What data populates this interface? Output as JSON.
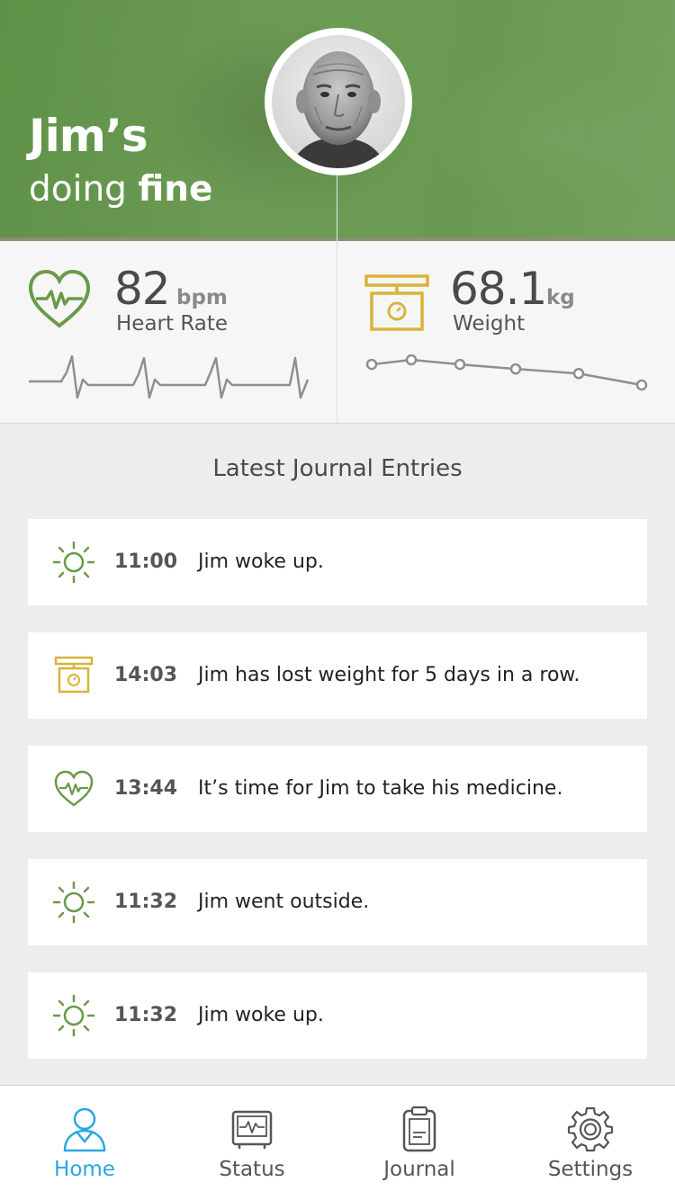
{
  "header": {
    "name": "Jim’s",
    "status_prefix": "doing",
    "status_word": "fine",
    "accent_color": "#6a9a52"
  },
  "stats": {
    "heart_rate": {
      "value": "82",
      "unit": "bpm",
      "label": "Heart Rate",
      "icon": "heart-icon",
      "color": "#6a9a4a"
    },
    "weight": {
      "value": "68.1",
      "unit": "kg",
      "label": "Weight",
      "icon": "scale-icon",
      "color": "#d8b43a",
      "trend": [
        69.0,
        69.2,
        69.0,
        68.8,
        68.6,
        68.1
      ]
    }
  },
  "journal": {
    "title": "Latest Journal Entries",
    "entries": [
      {
        "icon": "sun-icon",
        "time": "11:00",
        "text": "Jim woke up."
      },
      {
        "icon": "scale-icon",
        "time": "14:03",
        "text": "Jim has lost weight for 5 days in a row."
      },
      {
        "icon": "heart-icon",
        "time": "13:44",
        "text": "It’s time for Jim to take his medicine."
      },
      {
        "icon": "sun-icon",
        "time": "11:32",
        "text": "Jim went outside."
      },
      {
        "icon": "sun-icon",
        "time": "11:32",
        "text": "Jim woke up."
      }
    ]
  },
  "tabbar": {
    "active_color": "#2aa7e0",
    "tabs": [
      {
        "label": "Home",
        "icon": "person-icon",
        "active": true
      },
      {
        "label": "Status",
        "icon": "monitor-icon",
        "active": false
      },
      {
        "label": "Journal",
        "icon": "clipboard-icon",
        "active": false
      },
      {
        "label": "Settings",
        "icon": "gear-icon",
        "active": false
      }
    ]
  }
}
